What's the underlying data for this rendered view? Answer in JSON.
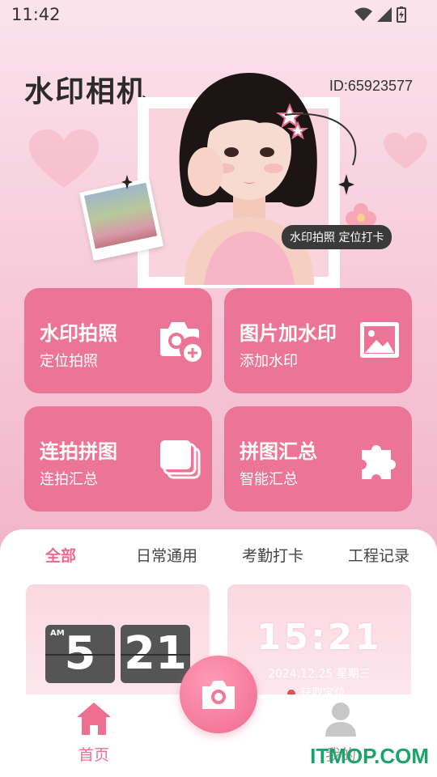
{
  "status_bar": {
    "time": "11:42"
  },
  "header": {
    "app_title": "水印相机",
    "user_id": "ID:65923577"
  },
  "hero": {
    "badge": "水印拍照 定位打卡"
  },
  "feature_cards": [
    {
      "title": "水印拍照",
      "subtitle": "定位拍照",
      "icon": "camera-plus-icon"
    },
    {
      "title": "图片加水印",
      "subtitle": "添加水印",
      "icon": "image-icon"
    },
    {
      "title": "连拍拼图",
      "subtitle": "连拍汇总",
      "icon": "stacked-cards-icon"
    },
    {
      "title": "拼图汇总",
      "subtitle": "智能汇总",
      "icon": "puzzle-icon"
    }
  ],
  "tabs": [
    {
      "label": "全部",
      "active": true
    },
    {
      "label": "日常通用",
      "active": false
    },
    {
      "label": "考勤打卡",
      "active": false
    },
    {
      "label": "工程记录",
      "active": false
    }
  ],
  "templates": {
    "flip_clock": {
      "am": "AM",
      "hour": "5",
      "minute": "21"
    },
    "digital": {
      "time": "15:21",
      "date": "2024.12.25 星期三",
      "location": "获取定位"
    }
  },
  "nav": [
    {
      "label": "首页",
      "icon": "home-icon",
      "active": true
    },
    {
      "label": "我的",
      "icon": "user-icon",
      "active": false
    }
  ],
  "watermark": "ITMOP.COM",
  "colors": {
    "accent": "#ec7496",
    "accent_text": "#ea6b8e"
  }
}
